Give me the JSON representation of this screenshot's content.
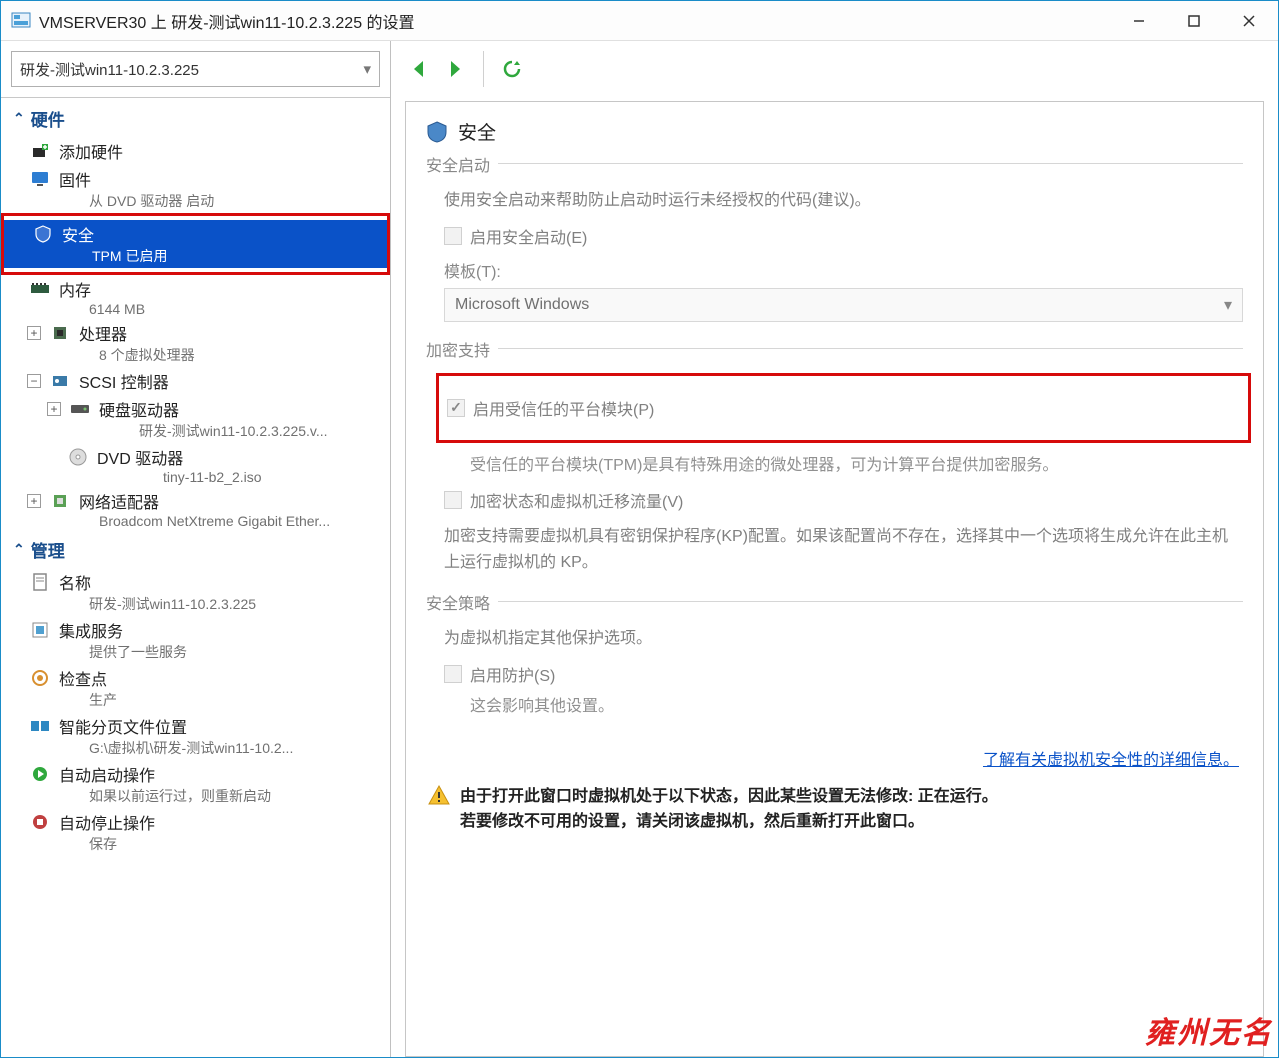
{
  "window": {
    "title": "VMSERVER30 上 研发-测试win11-10.2.3.225 的设置"
  },
  "vm_selector": {
    "value": "研发-测试win11-10.2.3.225"
  },
  "sections": {
    "hardware": "硬件",
    "management": "管理"
  },
  "tree": {
    "add_hardware": "添加硬件",
    "firmware": {
      "label": "固件",
      "sub": "从 DVD 驱动器 启动"
    },
    "security": {
      "label": "安全",
      "sub": "TPM 已启用"
    },
    "memory": {
      "label": "内存",
      "sub": "6144 MB"
    },
    "processor": {
      "label": "处理器",
      "sub": "8 个虚拟处理器"
    },
    "scsi": {
      "label": "SCSI 控制器"
    },
    "hdd": {
      "label": "硬盘驱动器",
      "sub": "研发-测试win11-10.2.3.225.v..."
    },
    "dvd": {
      "label": "DVD 驱动器",
      "sub": "tiny-11-b2_2.iso"
    },
    "network": {
      "label": "网络适配器",
      "sub": "Broadcom NetXtreme Gigabit Ether..."
    },
    "name": {
      "label": "名称",
      "sub": "研发-测试win11-10.2.3.225"
    },
    "integ": {
      "label": "集成服务",
      "sub": "提供了一些服务"
    },
    "checkpoint": {
      "label": "检查点",
      "sub": "生产"
    },
    "paging": {
      "label": "智能分页文件位置",
      "sub": "G:\\虚拟机\\研发-测试win11-10.2..."
    },
    "autostart": {
      "label": "自动启动操作",
      "sub": "如果以前运行过，则重新启动"
    },
    "autostop": {
      "label": "自动停止操作",
      "sub": "保存"
    }
  },
  "panel": {
    "title": "安全",
    "secure_boot": {
      "group": "安全启动",
      "desc": "使用安全启动来帮助防止启动时运行未经授权的代码(建议)。",
      "enable": "启用安全启动(E)",
      "template_label": "模板(T):",
      "template_value": "Microsoft Windows"
    },
    "encryption": {
      "group": "加密支持",
      "tpm": "启用受信任的平台模块(P)",
      "tpm_desc": "受信任的平台模块(TPM)是具有特殊用途的微处理器，可为计算平台提供加密服务。",
      "encrypt_state": "加密状态和虚拟机迁移流量(V)",
      "kp_desc": "加密支持需要虚拟机具有密钥保护程序(KP)配置。如果该配置尚不存在，选择其中一个选项将生成允许在此主机上运行虚拟机的 KP。"
    },
    "policy": {
      "group": "安全策略",
      "desc": "为虚拟机指定其他保护选项。",
      "shield": "启用防护(S)",
      "shield_desc": "这会影响其他设置。"
    },
    "link": "了解有关虚拟机安全性的详细信息。",
    "warning1": "由于打开此窗口时虚拟机处于以下状态，因此某些设置无法修改: 正在运行。",
    "warning2": "若要修改不可用的设置，请关闭该虚拟机，然后重新打开此窗口。"
  },
  "watermark": "雍州无名"
}
